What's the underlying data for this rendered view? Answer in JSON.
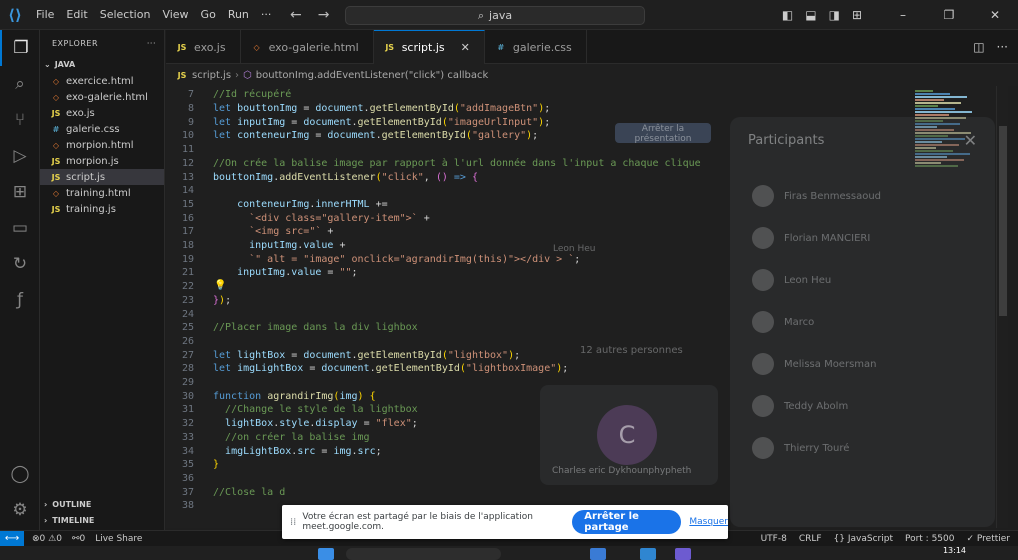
{
  "titlebar": {
    "menu": [
      "File",
      "Edit",
      "Selection",
      "View",
      "Go",
      "Run",
      "···"
    ],
    "search_text": "java",
    "window_buttons": [
      "–",
      "❐",
      "✕"
    ]
  },
  "sidebar": {
    "header": "EXPLORER",
    "folder": "JAVA",
    "files": [
      {
        "name": "exercice.html",
        "icon": "html"
      },
      {
        "name": "exo-galerie.html",
        "icon": "html"
      },
      {
        "name": "exo.js",
        "icon": "js"
      },
      {
        "name": "galerie.css",
        "icon": "css"
      },
      {
        "name": "morpion.html",
        "icon": "html"
      },
      {
        "name": "morpion.js",
        "icon": "js"
      },
      {
        "name": "script.js",
        "icon": "js",
        "active": true
      },
      {
        "name": "training.html",
        "icon": "html"
      },
      {
        "name": "training.js",
        "icon": "js"
      }
    ],
    "outline": "OUTLINE",
    "timeline": "TIMELINE"
  },
  "tabs": [
    {
      "label": "exo.js",
      "icon": "js",
      "active": false
    },
    {
      "label": "exo-galerie.html",
      "icon": "html",
      "active": false
    },
    {
      "label": "script.js",
      "icon": "js",
      "active": true
    },
    {
      "label": "galerie.css",
      "icon": "css",
      "active": false
    }
  ],
  "breadcrumb": {
    "file": "script.js",
    "symbol": "bouttonImg.addEventListener(\"click\") callback"
  },
  "code_lines": [
    {
      "n": "7",
      "tokens": [
        [
          "c-com",
          "//Id récupéré"
        ]
      ]
    },
    {
      "n": "8",
      "tokens": [
        [
          "c-kw",
          "let "
        ],
        [
          "c-var",
          "bouttonImg"
        ],
        [
          "c-op",
          " = "
        ],
        [
          "c-var",
          "document"
        ],
        [
          "c-op",
          "."
        ],
        [
          "c-fn",
          "getElementById"
        ],
        [
          "c-pun",
          "("
        ],
        [
          "c-str",
          "\"addImageBtn\""
        ],
        [
          "c-pun",
          ")"
        ],
        [
          "c-op",
          ";"
        ]
      ]
    },
    {
      "n": "9",
      "tokens": [
        [
          "c-kw",
          "let "
        ],
        [
          "c-var",
          "inputImg"
        ],
        [
          "c-op",
          " = "
        ],
        [
          "c-var",
          "document"
        ],
        [
          "c-op",
          "."
        ],
        [
          "c-fn",
          "getElementById"
        ],
        [
          "c-pun",
          "("
        ],
        [
          "c-str",
          "\"imageUrlInput\""
        ],
        [
          "c-pun",
          ")"
        ],
        [
          "c-op",
          ";"
        ]
      ]
    },
    {
      "n": "10",
      "tokens": [
        [
          "c-kw",
          "let "
        ],
        [
          "c-var",
          "conteneurImg"
        ],
        [
          "c-op",
          " = "
        ],
        [
          "c-var",
          "document"
        ],
        [
          "c-op",
          "."
        ],
        [
          "c-fn",
          "getElementById"
        ],
        [
          "c-pun",
          "("
        ],
        [
          "c-str",
          "\"gallery\""
        ],
        [
          "c-pun",
          ")"
        ],
        [
          "c-op",
          ";"
        ]
      ]
    },
    {
      "n": "11",
      "tokens": []
    },
    {
      "n": "12",
      "tokens": [
        [
          "c-com",
          "//On crée la balise image par rapport à l'url donnée dans l'input a chaque clique"
        ]
      ]
    },
    {
      "n": "13",
      "tokens": [
        [
          "c-var",
          "bouttonImg"
        ],
        [
          "c-op",
          "."
        ],
        [
          "c-fn",
          "addEventListener"
        ],
        [
          "c-pun",
          "("
        ],
        [
          "c-str",
          "\"click\""
        ],
        [
          "c-op",
          ", "
        ],
        [
          "c-br",
          "()"
        ],
        [
          "c-op",
          " "
        ],
        [
          "c-kw",
          "=>"
        ],
        [
          "c-op",
          " "
        ],
        [
          "c-br",
          "{"
        ]
      ]
    },
    {
      "n": "14",
      "tokens": []
    },
    {
      "n": "15",
      "tokens": [
        [
          "c-op",
          "    "
        ],
        [
          "c-var",
          "conteneurImg"
        ],
        [
          "c-op",
          "."
        ],
        [
          "c-var",
          "innerHTML"
        ],
        [
          "c-op",
          " +="
        ]
      ]
    },
    {
      "n": "16",
      "tokens": [
        [
          "c-op",
          "      "
        ],
        [
          "c-str",
          "`<div class=\"gallery-item\">`"
        ],
        [
          "c-op",
          " +"
        ]
      ]
    },
    {
      "n": "17",
      "tokens": [
        [
          "c-op",
          "      "
        ],
        [
          "c-str",
          "`<img src=\"`"
        ],
        [
          "c-op",
          " +"
        ]
      ]
    },
    {
      "n": "18",
      "tokens": [
        [
          "c-op",
          "      "
        ],
        [
          "c-var",
          "inputImg"
        ],
        [
          "c-op",
          "."
        ],
        [
          "c-var",
          "value"
        ],
        [
          "c-op",
          " +"
        ]
      ]
    },
    {
      "n": "19",
      "tokens": [
        [
          "c-op",
          "      "
        ],
        [
          "c-str",
          "`\" alt = \"image\" onclick=\"agrandirImg(this)\"></div > `"
        ],
        [
          "c-op",
          ";"
        ]
      ]
    },
    {
      "n": "21",
      "tokens": [
        [
          "c-op",
          "    "
        ],
        [
          "c-var",
          "inputImg"
        ],
        [
          "c-op",
          "."
        ],
        [
          "c-var",
          "value"
        ],
        [
          "c-op",
          " = "
        ],
        [
          "c-str",
          "\"\""
        ],
        [
          "c-op",
          ";"
        ]
      ]
    },
    {
      "n": "22",
      "tokens": []
    },
    {
      "n": "23",
      "tokens": [
        [
          "c-br",
          "}"
        ],
        [
          "c-pun",
          ")"
        ],
        [
          "c-op",
          ";"
        ]
      ]
    },
    {
      "n": "24",
      "tokens": []
    },
    {
      "n": "25",
      "tokens": [
        [
          "c-com",
          "//Placer image dans la div lighbox"
        ]
      ]
    },
    {
      "n": "26",
      "tokens": []
    },
    {
      "n": "27",
      "tokens": [
        [
          "c-kw",
          "let "
        ],
        [
          "c-var",
          "lightBox"
        ],
        [
          "c-op",
          " = "
        ],
        [
          "c-var",
          "document"
        ],
        [
          "c-op",
          "."
        ],
        [
          "c-fn",
          "getElementById"
        ],
        [
          "c-pun",
          "("
        ],
        [
          "c-str",
          "\"lightbox\""
        ],
        [
          "c-pun",
          ")"
        ],
        [
          "c-op",
          ";"
        ]
      ]
    },
    {
      "n": "28",
      "tokens": [
        [
          "c-kw",
          "let "
        ],
        [
          "c-var",
          "imgLightBox"
        ],
        [
          "c-op",
          " = "
        ],
        [
          "c-var",
          "document"
        ],
        [
          "c-op",
          "."
        ],
        [
          "c-fn",
          "getElementById"
        ],
        [
          "c-pun",
          "("
        ],
        [
          "c-str",
          "\"lightboxImage\""
        ],
        [
          "c-pun",
          ")"
        ],
        [
          "c-op",
          ";"
        ]
      ]
    },
    {
      "n": "29",
      "tokens": []
    },
    {
      "n": "30",
      "tokens": [
        [
          "c-kw",
          "function "
        ],
        [
          "c-fn",
          "agrandirImg"
        ],
        [
          "c-pun",
          "("
        ],
        [
          "c-var",
          "img"
        ],
        [
          "c-pun",
          ")"
        ],
        [
          "c-op",
          " "
        ],
        [
          "c-pun",
          "{"
        ]
      ]
    },
    {
      "n": "31",
      "tokens": [
        [
          "c-op",
          "  "
        ],
        [
          "c-com",
          "//Change le style de la lightbox"
        ]
      ]
    },
    {
      "n": "32",
      "tokens": [
        [
          "c-op",
          "  "
        ],
        [
          "c-var",
          "lightBox"
        ],
        [
          "c-op",
          "."
        ],
        [
          "c-var",
          "style"
        ],
        [
          "c-op",
          "."
        ],
        [
          "c-var",
          "display"
        ],
        [
          "c-op",
          " = "
        ],
        [
          "c-str",
          "\"flex\""
        ],
        [
          "c-op",
          ";"
        ]
      ]
    },
    {
      "n": "33",
      "tokens": [
        [
          "c-op",
          "  "
        ],
        [
          "c-com",
          "//on créer la balise img"
        ]
      ]
    },
    {
      "n": "34",
      "tokens": [
        [
          "c-op",
          "  "
        ],
        [
          "c-var",
          "imgLightBox"
        ],
        [
          "c-op",
          "."
        ],
        [
          "c-var",
          "src"
        ],
        [
          "c-op",
          " = "
        ],
        [
          "c-var",
          "img"
        ],
        [
          "c-op",
          "."
        ],
        [
          "c-var",
          "src"
        ],
        [
          "c-op",
          ";"
        ]
      ]
    },
    {
      "n": "35",
      "tokens": [
        [
          "c-pun",
          "}"
        ]
      ]
    },
    {
      "n": "36",
      "tokens": []
    },
    {
      "n": "37",
      "tokens": [
        [
          "c-com",
          "//Close la d"
        ]
      ]
    },
    {
      "n": "38",
      "tokens": []
    }
  ],
  "overlay": {
    "participants_title": "Participants",
    "present_button": "Arrêter la présentation",
    "leon": "Leon Heu",
    "others": "12 autres personnes",
    "tile_initial": "C",
    "tile_name": "Charles eric Dykhounphypheth",
    "names": [
      "Firas Benmessaoud",
      "Florian MANCIERI",
      "Leon Heu",
      "Marco",
      "Melissa Moersman",
      "Teddy Abolm",
      "Thierry Touré"
    ]
  },
  "share_banner": {
    "grip": "⁞⁞",
    "text": "Votre écran est partagé par le biais de l'application meet.google.com.",
    "stop": "Arrêter le partage",
    "hide": "Masquer"
  },
  "statusbar": {
    "remote": "⟷",
    "errors": "⊗0 ⚠0",
    "ports": "⚯0",
    "liveshare": "Live Share",
    "right": [
      "UTF-8",
      "CRLF",
      "{} JavaScript",
      "Port : 5500",
      "✓ Prettier"
    ]
  },
  "taskbar": {
    "clock": "13:14"
  },
  "colors": {
    "accent": "#0078d4",
    "editor_bg": "#1f1f1f",
    "share_blue": "#1a73e8"
  }
}
